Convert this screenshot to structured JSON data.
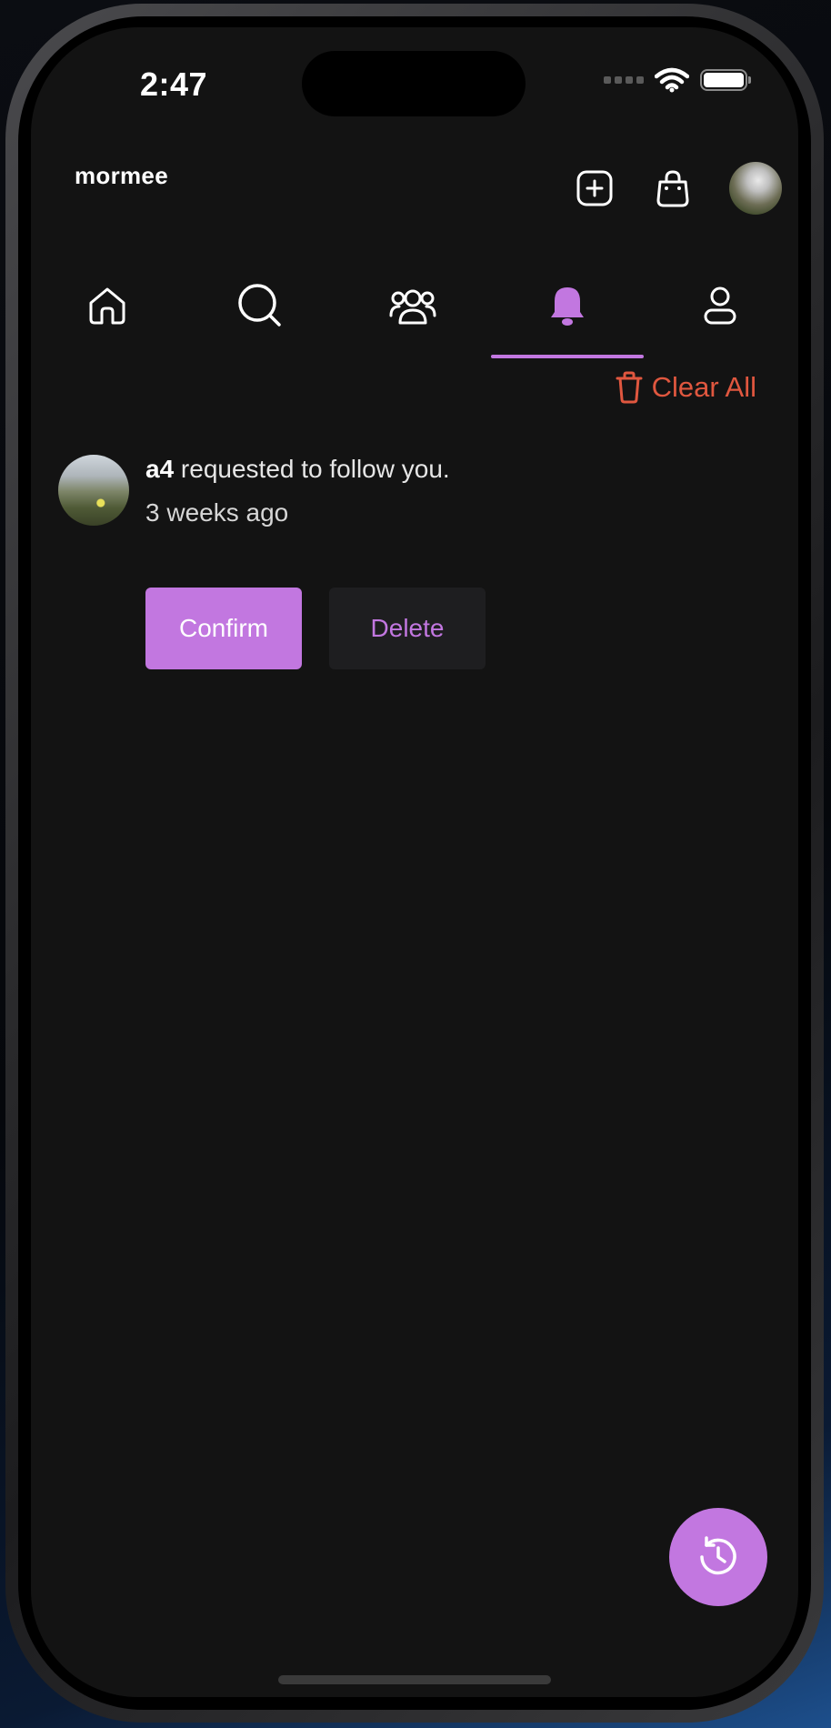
{
  "status_bar": {
    "time": "2:47"
  },
  "header": {
    "brand": "mormee",
    "actions": {
      "create_icon": "plus-square-icon",
      "cart_icon": "shopping-bag-icon",
      "avatar_icon": "profile-avatar"
    }
  },
  "tabs": [
    {
      "name": "home",
      "icon": "home-icon",
      "active": false
    },
    {
      "name": "search",
      "icon": "search-icon",
      "active": false
    },
    {
      "name": "community",
      "icon": "group-icon",
      "active": false
    },
    {
      "name": "notifications",
      "icon": "bell-icon",
      "active": true
    },
    {
      "name": "profile",
      "icon": "user-icon",
      "active": false
    }
  ],
  "toolbar": {
    "clear_all_label": "Clear All",
    "clear_all_icon": "trash-icon"
  },
  "notifications": [
    {
      "username": "a4",
      "message": " requested to follow you.",
      "time": "3 weeks ago",
      "confirm_label": "Confirm",
      "delete_label": "Delete"
    }
  ],
  "fab": {
    "icon": "history-icon"
  },
  "colors": {
    "accent": "#c277e0",
    "danger": "#e0573f",
    "background": "#131313"
  }
}
